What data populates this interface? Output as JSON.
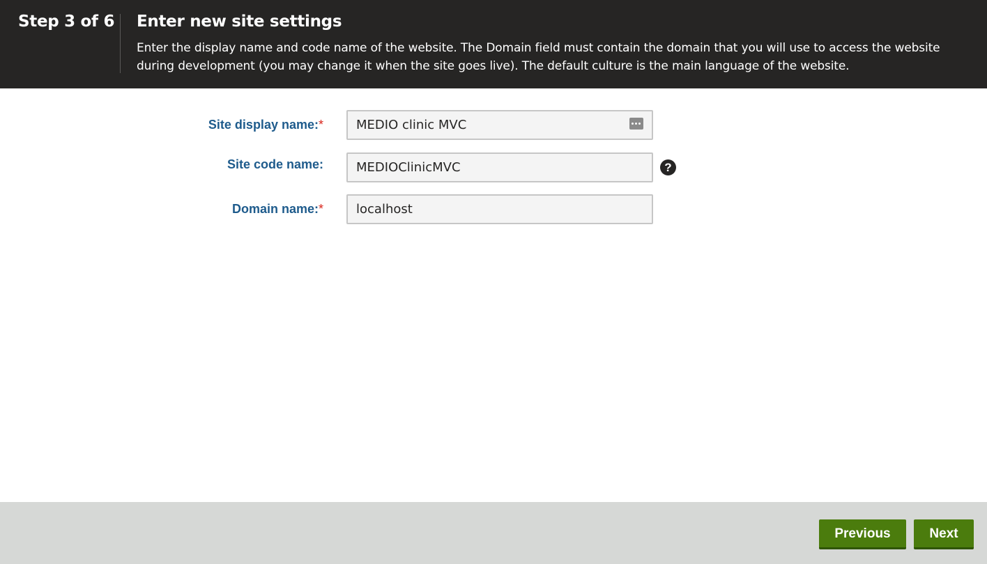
{
  "header": {
    "step": "Step 3 of 6",
    "title": "Enter new site settings",
    "description": "Enter the display name and code name of the website. The Domain field must contain the domain that you will use to access the website during development (you may change it when the site goes live). The default culture is the main language of the website."
  },
  "form": {
    "site_display_name": {
      "label": "Site display name:",
      "required_mark": "*",
      "value": "MEDIO clinic MVC",
      "icon": "password-manager-icon"
    },
    "site_code_name": {
      "label": "Site code name:",
      "value": "MEDIOClinicMVC",
      "help_icon": "?"
    },
    "domain_name": {
      "label": "Domain name:",
      "required_mark": "*",
      "value": "localhost"
    }
  },
  "footer": {
    "previous_label": "Previous",
    "next_label": "Next"
  },
  "colors": {
    "header_bg": "#262524",
    "label": "#1e5b8c",
    "required": "#d9261c",
    "button_bg": "#4b7c0d",
    "footer_bg": "#d6d8d6"
  }
}
